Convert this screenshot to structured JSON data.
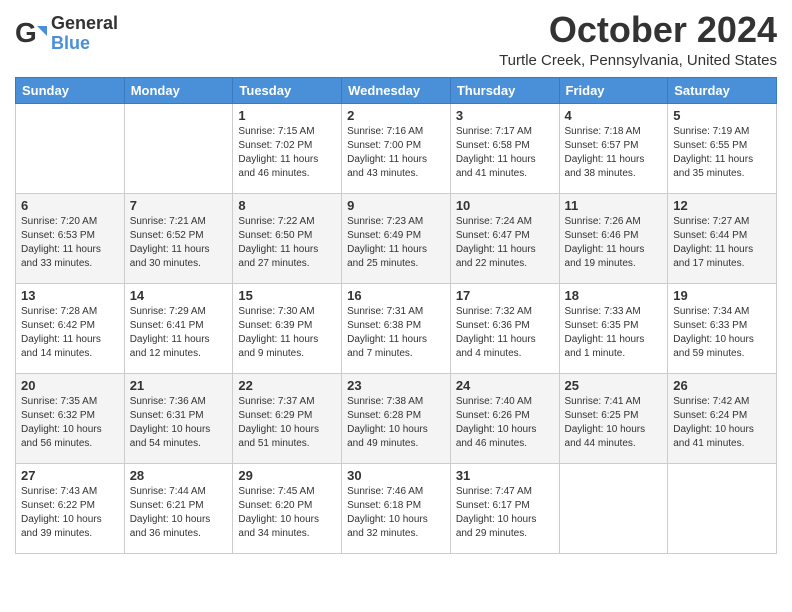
{
  "header": {
    "logo_general": "General",
    "logo_blue": "Blue",
    "month_title": "October 2024",
    "location": "Turtle Creek, Pennsylvania, United States"
  },
  "days_of_week": [
    "Sunday",
    "Monday",
    "Tuesday",
    "Wednesday",
    "Thursday",
    "Friday",
    "Saturday"
  ],
  "weeks": [
    [
      {
        "day": "",
        "info": ""
      },
      {
        "day": "",
        "info": ""
      },
      {
        "day": "1",
        "info": "Sunrise: 7:15 AM\nSunset: 7:02 PM\nDaylight: 11 hours and 46 minutes."
      },
      {
        "day": "2",
        "info": "Sunrise: 7:16 AM\nSunset: 7:00 PM\nDaylight: 11 hours and 43 minutes."
      },
      {
        "day": "3",
        "info": "Sunrise: 7:17 AM\nSunset: 6:58 PM\nDaylight: 11 hours and 41 minutes."
      },
      {
        "day": "4",
        "info": "Sunrise: 7:18 AM\nSunset: 6:57 PM\nDaylight: 11 hours and 38 minutes."
      },
      {
        "day": "5",
        "info": "Sunrise: 7:19 AM\nSunset: 6:55 PM\nDaylight: 11 hours and 35 minutes."
      }
    ],
    [
      {
        "day": "6",
        "info": "Sunrise: 7:20 AM\nSunset: 6:53 PM\nDaylight: 11 hours and 33 minutes."
      },
      {
        "day": "7",
        "info": "Sunrise: 7:21 AM\nSunset: 6:52 PM\nDaylight: 11 hours and 30 minutes."
      },
      {
        "day": "8",
        "info": "Sunrise: 7:22 AM\nSunset: 6:50 PM\nDaylight: 11 hours and 27 minutes."
      },
      {
        "day": "9",
        "info": "Sunrise: 7:23 AM\nSunset: 6:49 PM\nDaylight: 11 hours and 25 minutes."
      },
      {
        "day": "10",
        "info": "Sunrise: 7:24 AM\nSunset: 6:47 PM\nDaylight: 11 hours and 22 minutes."
      },
      {
        "day": "11",
        "info": "Sunrise: 7:26 AM\nSunset: 6:46 PM\nDaylight: 11 hours and 19 minutes."
      },
      {
        "day": "12",
        "info": "Sunrise: 7:27 AM\nSunset: 6:44 PM\nDaylight: 11 hours and 17 minutes."
      }
    ],
    [
      {
        "day": "13",
        "info": "Sunrise: 7:28 AM\nSunset: 6:42 PM\nDaylight: 11 hours and 14 minutes."
      },
      {
        "day": "14",
        "info": "Sunrise: 7:29 AM\nSunset: 6:41 PM\nDaylight: 11 hours and 12 minutes."
      },
      {
        "day": "15",
        "info": "Sunrise: 7:30 AM\nSunset: 6:39 PM\nDaylight: 11 hours and 9 minutes."
      },
      {
        "day": "16",
        "info": "Sunrise: 7:31 AM\nSunset: 6:38 PM\nDaylight: 11 hours and 7 minutes."
      },
      {
        "day": "17",
        "info": "Sunrise: 7:32 AM\nSunset: 6:36 PM\nDaylight: 11 hours and 4 minutes."
      },
      {
        "day": "18",
        "info": "Sunrise: 7:33 AM\nSunset: 6:35 PM\nDaylight: 11 hours and 1 minute."
      },
      {
        "day": "19",
        "info": "Sunrise: 7:34 AM\nSunset: 6:33 PM\nDaylight: 10 hours and 59 minutes."
      }
    ],
    [
      {
        "day": "20",
        "info": "Sunrise: 7:35 AM\nSunset: 6:32 PM\nDaylight: 10 hours and 56 minutes."
      },
      {
        "day": "21",
        "info": "Sunrise: 7:36 AM\nSunset: 6:31 PM\nDaylight: 10 hours and 54 minutes."
      },
      {
        "day": "22",
        "info": "Sunrise: 7:37 AM\nSunset: 6:29 PM\nDaylight: 10 hours and 51 minutes."
      },
      {
        "day": "23",
        "info": "Sunrise: 7:38 AM\nSunset: 6:28 PM\nDaylight: 10 hours and 49 minutes."
      },
      {
        "day": "24",
        "info": "Sunrise: 7:40 AM\nSunset: 6:26 PM\nDaylight: 10 hours and 46 minutes."
      },
      {
        "day": "25",
        "info": "Sunrise: 7:41 AM\nSunset: 6:25 PM\nDaylight: 10 hours and 44 minutes."
      },
      {
        "day": "26",
        "info": "Sunrise: 7:42 AM\nSunset: 6:24 PM\nDaylight: 10 hours and 41 minutes."
      }
    ],
    [
      {
        "day": "27",
        "info": "Sunrise: 7:43 AM\nSunset: 6:22 PM\nDaylight: 10 hours and 39 minutes."
      },
      {
        "day": "28",
        "info": "Sunrise: 7:44 AM\nSunset: 6:21 PM\nDaylight: 10 hours and 36 minutes."
      },
      {
        "day": "29",
        "info": "Sunrise: 7:45 AM\nSunset: 6:20 PM\nDaylight: 10 hours and 34 minutes."
      },
      {
        "day": "30",
        "info": "Sunrise: 7:46 AM\nSunset: 6:18 PM\nDaylight: 10 hours and 32 minutes."
      },
      {
        "day": "31",
        "info": "Sunrise: 7:47 AM\nSunset: 6:17 PM\nDaylight: 10 hours and 29 minutes."
      },
      {
        "day": "",
        "info": ""
      },
      {
        "day": "",
        "info": ""
      }
    ]
  ]
}
